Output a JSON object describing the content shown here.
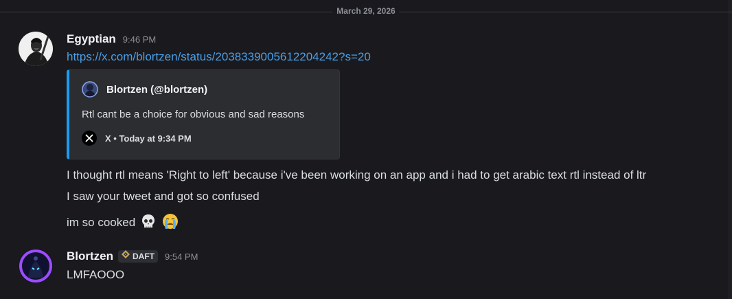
{
  "date_divider": "March 29, 2026",
  "messages": [
    {
      "username": "Egyptian",
      "timestamp": "9:46 PM",
      "link": "https://x.com/blortzen/status/2038339005612204242?s=20",
      "embed": {
        "author": "Blortzen (@blortzen)",
        "description": "Rtl cant be a choice for obvious and sad reasons",
        "footer": "X • Today at 9:34 PM",
        "accent_color": "#1d9bf0"
      },
      "lines": [
        "I thought rtl means 'Right to left' because i've been working on an app and i had to get arabic text rtl instead of ltr",
        "I saw your tweet and got so confused",
        "im so cooked"
      ],
      "emojis": [
        "skull-emoji",
        "loudly-crying-face-emoji"
      ]
    },
    {
      "username": "Blortzen",
      "badge": "DAFT",
      "timestamp": "9:54 PM",
      "lines": [
        "LMFAOOO"
      ]
    }
  ],
  "colors": {
    "background": "#1a1a1e",
    "link": "#4a9fe8",
    "embed_bg": "#2b2d31"
  }
}
